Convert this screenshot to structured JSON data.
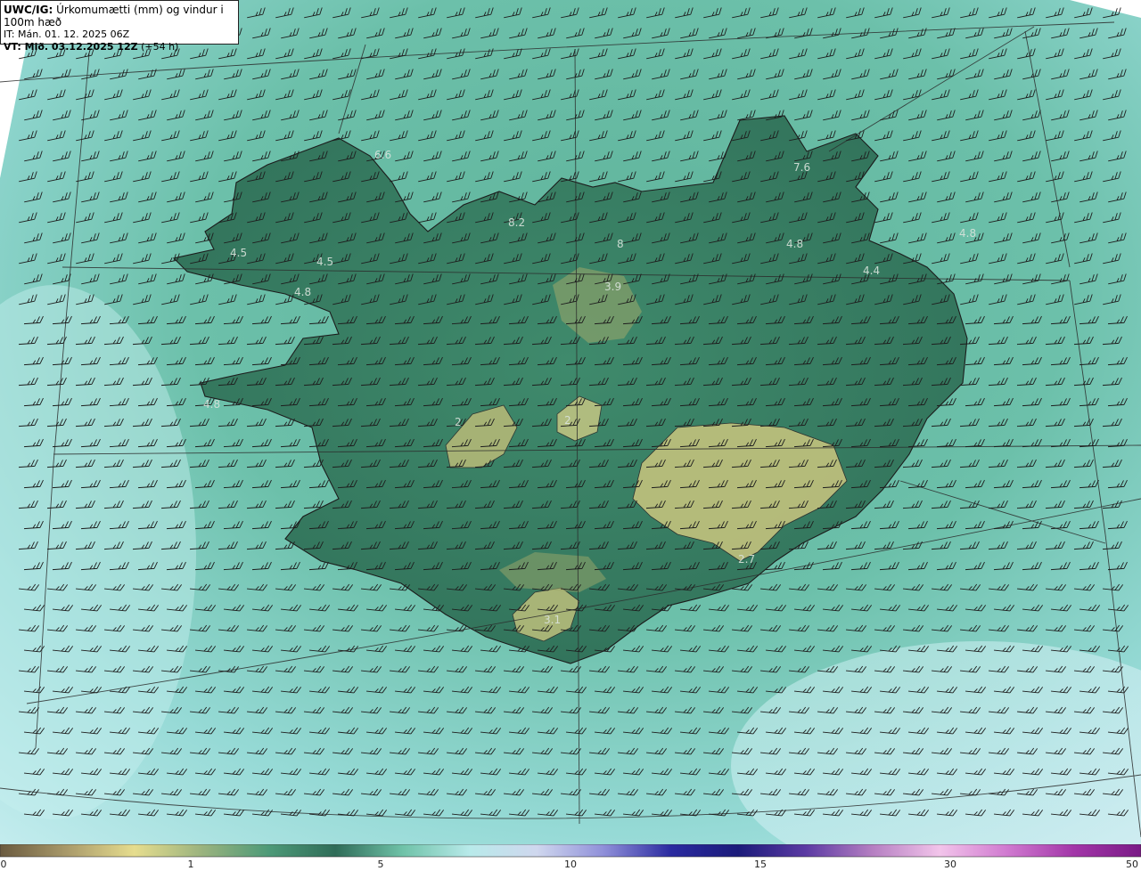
{
  "info": {
    "model": "UWC/IG:",
    "title": "Úrkomumætti (mm) og vindur i 100m hæð",
    "init_time": "IT: Mán. 01. 12. 2025 06Z",
    "valid_prefix": "VT: Mið. 03.12.2025 12Z",
    "valid_suffix": " (+54 h)"
  },
  "colors": {
    "sea": "#8fd5d2",
    "land_low": "#4e9b7a",
    "land_mid": "#2f6e57",
    "highland": "#b5b874",
    "coast": "#1c1c1c",
    "grid": "#2a2a2a",
    "barb": "#1e1e1e"
  },
  "map_labels": [
    "4.5",
    "4.5",
    "4.8",
    "8.2",
    "8",
    "3.9",
    "4.8",
    "7.6",
    "4.4",
    "4.8",
    "2",
    "2",
    "2.7",
    "3.1",
    "6.6",
    "4.8"
  ],
  "colorbar": {
    "ticks": [
      "0",
      "1",
      "5",
      "10",
      "15",
      "30",
      "50"
    ],
    "stops": [
      "#6a5a3f",
      "#a99a6a",
      "#e6dd8e",
      "#9bb37e",
      "#4d9a78",
      "#2f6c58",
      "#6fc2a8",
      "#b8eaea",
      "#cfd7ee",
      "#8f8fd9",
      "#2a2aa0",
      "#1b1b7a",
      "#5b3aa3",
      "#b57fc2",
      "#f2c4ea",
      "#d07ad0",
      "#a236a8",
      "#7a1a86"
    ]
  },
  "icons": {
    "barbs": "wind-barb-icon"
  }
}
